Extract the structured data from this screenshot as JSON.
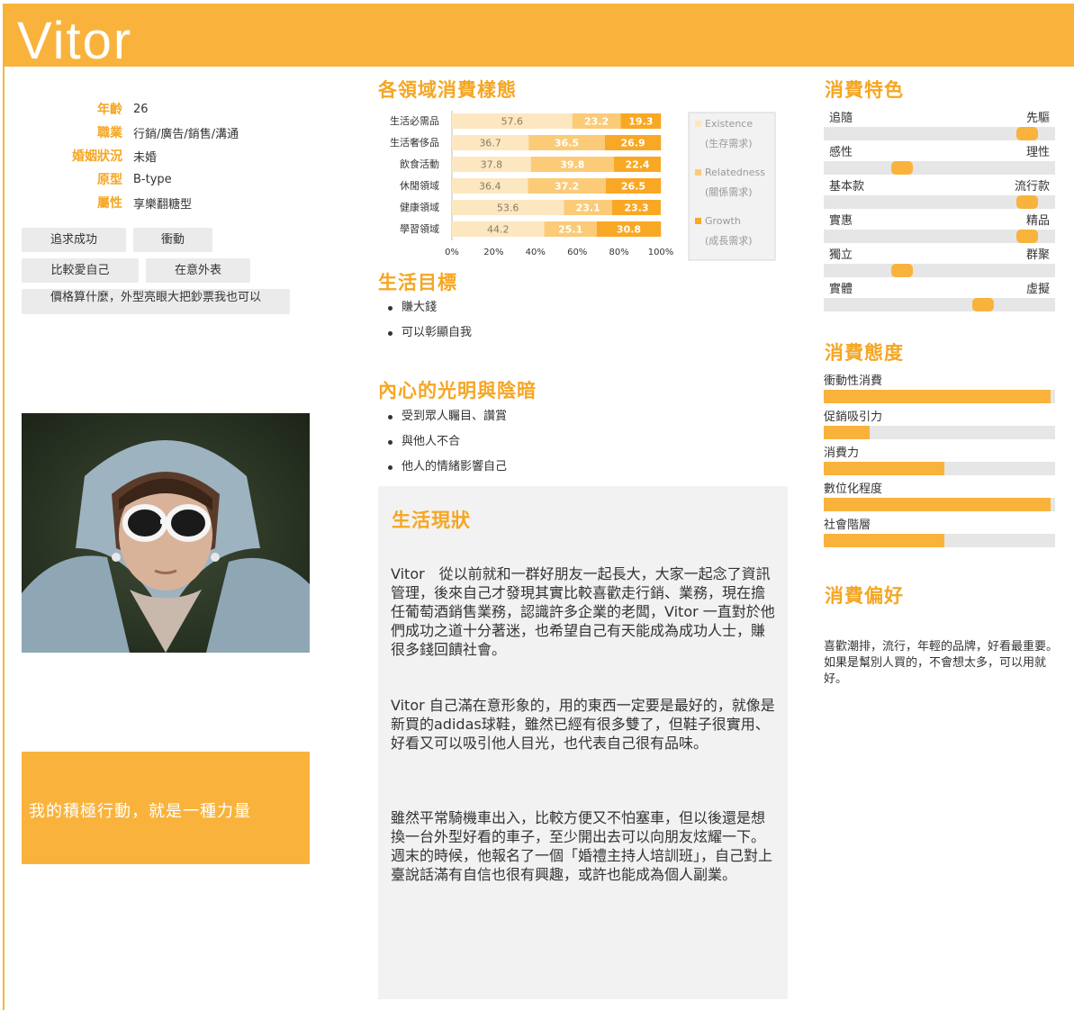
{
  "header": {
    "name": "Vitor"
  },
  "profile": [
    {
      "key": "年齡",
      "value": "26"
    },
    {
      "key": "職業",
      "value": "行銷/廣告/銷售/溝通"
    },
    {
      "key": "婚姻狀況",
      "value": "未婚"
    },
    {
      "key": "原型",
      "value": "B-type"
    },
    {
      "key": "屬性",
      "value": "享樂翻糖型"
    }
  ],
  "tags": [
    "追求成功",
    "衝動",
    "比較愛自己",
    "在意外表",
    "價格算什麼，外型亮眼大把鈔票我也可以"
  ],
  "quote": "我的積極行動，就是一種力量",
  "sections": {
    "consumption_pattern": "各領域消費樣態",
    "life_goal": "生活目標",
    "inner": "內心的光明與陰暗",
    "status": "生活現狀",
    "traits": "消費特色",
    "attitude": "消費態度",
    "preference": "消費偏好"
  },
  "life_goals": [
    "賺大錢",
    "可以彰顯自我"
  ],
  "inner_items": [
    "受到眾人矚目、讚賞",
    "與他人不合",
    "他人的情緒影響自己"
  ],
  "status_paragraphs": [
    "Vitor　從以前就和一群好朋友一起長大，大家一起念了資訊管理，後來自己才發現其實比較喜歡走行銷、業務，現在擔任葡萄酒銷售業務，認識許多企業的老闆，Vitor 一直對於他們成功之道十分著迷，也希望自己有天能成為成功人士，賺很多錢回饋社會。",
    "Vitor 自己滿在意形象的，用的東西一定要是最好的，就像是新買的adidas球鞋，雖然已經有很多雙了，但鞋子很實用、好看又可以吸引他人目光，也代表自己很有品味。",
    "雖然平常騎機車出入，比較方便又不怕塞車，但以後還是想換一台外型好看的車子，至少開出去可以向朋友炫耀一下。週末的時候，他報名了一個「婚禮主持人培訓班」，自己對上臺說話滿有自信也很有興趣，或許也能成為個人副業。"
  ],
  "traits": [
    {
      "left": "追隨",
      "right": "先驅",
      "value": 0.92
    },
    {
      "left": "感性",
      "right": "理性",
      "value": 0.32
    },
    {
      "left": "基本款",
      "right": "流行款",
      "value": 0.92
    },
    {
      "left": "實惠",
      "right": "精品",
      "value": 0.92
    },
    {
      "left": "獨立",
      "right": "群聚",
      "value": 0.32
    },
    {
      "left": "實體",
      "right": "虛擬",
      "value": 0.71
    }
  ],
  "attitudes": [
    {
      "label": "衝動性消費",
      "value": 0.98
    },
    {
      "label": "促銷吸引力",
      "value": 0.2
    },
    {
      "label": "消費力",
      "value": 0.52
    },
    {
      "label": "數位化程度",
      "value": 0.98
    },
    {
      "label": "社會階層",
      "value": 0.52
    }
  ],
  "preference_text": "喜歡潮排，流行，年輕的品牌，好看最重要。如果是幫別人買的，不會想太多，可以用就好。",
  "colors": {
    "accent": "#f9b33c",
    "accent_text": "#f5a623",
    "existence": "#fde7c0",
    "relatedness": "#fbcb78",
    "growth": "#f9a825"
  },
  "chart_data": {
    "type": "bar",
    "orientation": "horizontal",
    "stacked": true,
    "categories": [
      "生活必需品",
      "生活奢侈品",
      "飲食活動",
      "休閒領域",
      "健康領域",
      "學習領域"
    ],
    "series": [
      {
        "name": "Existence",
        "sublabel": "(生存需求)",
        "values": [
          57.6,
          36.7,
          37.8,
          36.4,
          53.6,
          44.2
        ]
      },
      {
        "name": "Relatedness",
        "sublabel": "(關係需求)",
        "values": [
          23.2,
          36.5,
          39.8,
          37.2,
          23.1,
          25.1
        ]
      },
      {
        "name": "Growth",
        "sublabel": "(成長需求)",
        "values": [
          19.3,
          26.9,
          22.4,
          26.5,
          23.3,
          30.8
        ]
      }
    ],
    "xticks": [
      "0%",
      "20%",
      "40%",
      "60%",
      "80%",
      "100%"
    ],
    "xlim": [
      0,
      100
    ],
    "legend": "right"
  }
}
